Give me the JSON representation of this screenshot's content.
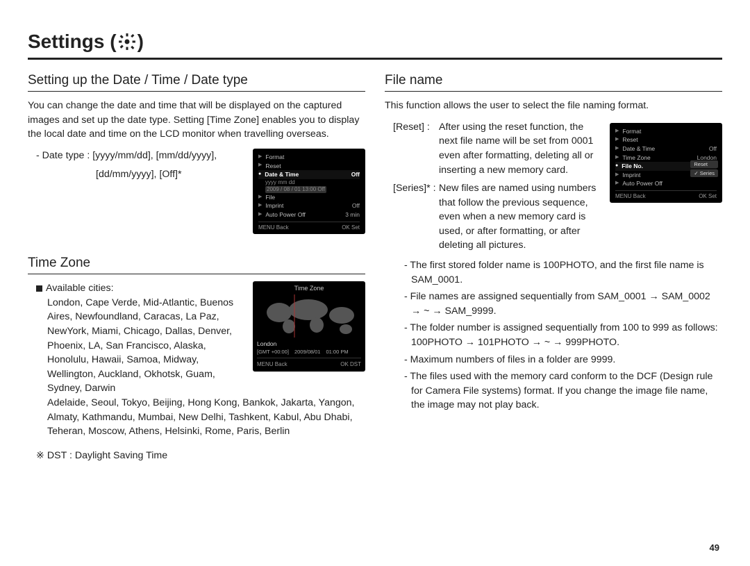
{
  "page": {
    "title_prefix": "Settings ( ",
    "title_suffix": " )",
    "page_number": "49"
  },
  "left": {
    "heading1": "Setting up the Date / Time / Date type",
    "intro": "You can change the date and time that will be displayed on the captured images and set up the date type. Setting [Time Zone] enables you to display the local date and time on the LCD monitor when travelling overseas.",
    "date_type_line1": "- Date type : [yyyy/mm/dd], [mm/dd/yyyy],",
    "date_type_line2": "  [dd/mm/yyyy], [Off]*",
    "lcd1": {
      "rows": [
        {
          "l": "Format",
          "r": ""
        },
        {
          "l": "Reset",
          "r": ""
        },
        {
          "l": "Date & Time",
          "r": "Off",
          "sel": true
        },
        {
          "sub": true,
          "text1": "yyyy mm dd",
          "text2": ""
        },
        {
          "sub": true,
          "text1": "2009 / 08 / 01   13:00   Off",
          "text2": ""
        },
        {
          "l": "File",
          "r": ""
        },
        {
          "l": "Imprint",
          "r": "Off"
        },
        {
          "l": "Auto Power Off",
          "r": "3 min"
        }
      ],
      "foot_left": "MENU Back",
      "foot_right": "OK Set"
    },
    "heading2": "Time Zone",
    "avail_label": "Available cities:",
    "cities_block_a": "London, Cape Verde, Mid-Atlantic, Buenos Aires, Newfoundland, Caracas, La Paz, NewYork, Miami, Chicago, Dallas, Denver, Phoenix, LA, San Francisco, Alaska, Honolulu, Hawaii, Samoa, Midway, Wellington, Auckland, Okhotsk, Guam, Sydney, Darwin",
    "cities_block_b": "Adelaide, Seoul, Tokyo, Beijing, Hong Kong, Bankok, Jakarta, Yangon, Almaty, Kathmandu, Mumbai, New Delhi, Tashkent, Kabul, Abu Dhabi, Teheran, Moscow, Athens, Helsinki, Rome, Paris, Berlin",
    "dst_note": "DST : Daylight Saving Time",
    "worldmap": {
      "title": "Time Zone",
      "city": "London",
      "gmt": "[GMT +00:00]",
      "date": "2009/08/01",
      "time": "01:00 PM",
      "foot_left": "MENU Back",
      "foot_right": "OK DST"
    }
  },
  "right": {
    "heading": "File name",
    "intro": "This function allows the user to select the file naming format.",
    "reset_label": "[Reset]",
    "reset_sep": ":",
    "reset_body": "After using the reset function, the next file name will be set from 0001 even after formatting, deleting all or inserting a new memory card.",
    "series_label": "[Series]*",
    "series_sep": ":",
    "series_body": "New files are named using numbers that follow the previous sequence, even when a new memory card is used, or after formatting, or after deleting all pictures.",
    "bullets": [
      "- The first stored folder name is 100PHOTO, and the first file name is SAM_0001.",
      "- File names are assigned sequentially from SAM_0001 → SAM_0002 → ~ → SAM_9999.",
      "- The folder number is assigned sequentially from 100 to 999 as follows: 100PHOTO → 101PHOTO → ~ → 999PHOTO.",
      "- Maximum numbers of files in a folder are 9999.",
      "- The files used with the memory card conform to the DCF (Design rule for Camera File systems) format. If you change the image file name, the image may not play back."
    ],
    "lcd2": {
      "rows": [
        {
          "l": "Format",
          "r": ""
        },
        {
          "l": "Reset",
          "r": ""
        },
        {
          "l": "Date & Time",
          "r": "Off"
        },
        {
          "l": "Time Zone",
          "r": "London"
        },
        {
          "l": "File No.",
          "r": "",
          "sel": true
        },
        {
          "l": "Imprint",
          "r": ""
        },
        {
          "l": "Auto Power Off",
          "r": ""
        }
      ],
      "opt_reset": "Reset",
      "opt_series": "✓ Series",
      "foot_left": "MENU Back",
      "foot_right": "OK Set"
    }
  }
}
